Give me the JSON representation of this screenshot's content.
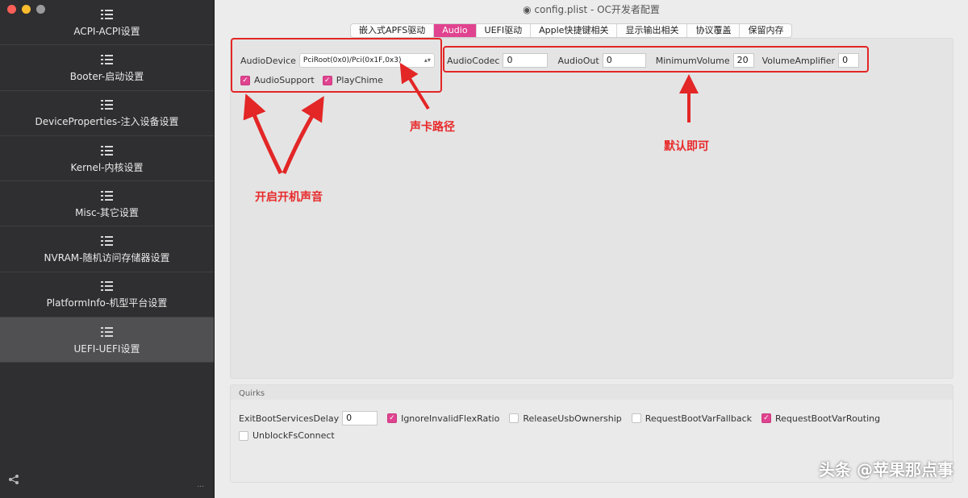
{
  "window": {
    "title": "config.plist - OC开发者配置"
  },
  "sidebar": {
    "items": [
      {
        "label": "ACPI-ACPI设置"
      },
      {
        "label": "Booter-启动设置"
      },
      {
        "label": "DeviceProperties-注入设备设置"
      },
      {
        "label": "Kernel-内核设置"
      },
      {
        "label": "Misc-其它设置"
      },
      {
        "label": "NVRAM-随机访问存储器设置"
      },
      {
        "label": "PlatformInfo-机型平台设置"
      },
      {
        "label": "UEFI-UEFI设置"
      }
    ],
    "bottom_right": "..."
  },
  "tabs": [
    {
      "label": "嵌入式APFS驱动"
    },
    {
      "label": "Audio"
    },
    {
      "label": "UEFI驱动"
    },
    {
      "label": "Apple快捷键相关"
    },
    {
      "label": "显示输出相关"
    },
    {
      "label": "协议覆盖"
    },
    {
      "label": "保留内存"
    }
  ],
  "audio": {
    "audio_device_label": "AudioDevice",
    "audio_device_value": "PciRoot(0x0)/Pci(0x1F,0x3)",
    "audio_support_label": "AudioSupport",
    "play_chime_label": "PlayChime",
    "audio_codec_label": "AudioCodec",
    "audio_codec_value": "0",
    "audio_out_label": "AudioOut",
    "audio_out_value": "0",
    "minimum_volume_label": "MinimumVolume",
    "minimum_volume_value": "20",
    "volume_amplifier_label": "VolumeAmplifier",
    "volume_amplifier_value": "0"
  },
  "annotations": {
    "sound_card_path": "声卡路径",
    "default_ok": "默认即可",
    "enable_boot_sound": "开启开机声音"
  },
  "quirks": {
    "title": "Quirks",
    "exit_boot_services_delay_label": "ExitBootServicesDelay",
    "exit_boot_services_delay_value": "0",
    "ignore_invalid_flex_ratio": "IgnoreInvalidFlexRatio",
    "release_usb_ownership": "ReleaseUsbOwnership",
    "request_boot_var_fallback": "RequestBootVarFallback",
    "request_boot_var_routing": "RequestBootVarRouting",
    "unblock_fs_connect": "UnblockFsConnect"
  },
  "watermark": "头条 @苹果那点事",
  "colors": {
    "accent": "#e0438f",
    "annotation": "#e32626",
    "sidebar": "#2f2f31"
  }
}
